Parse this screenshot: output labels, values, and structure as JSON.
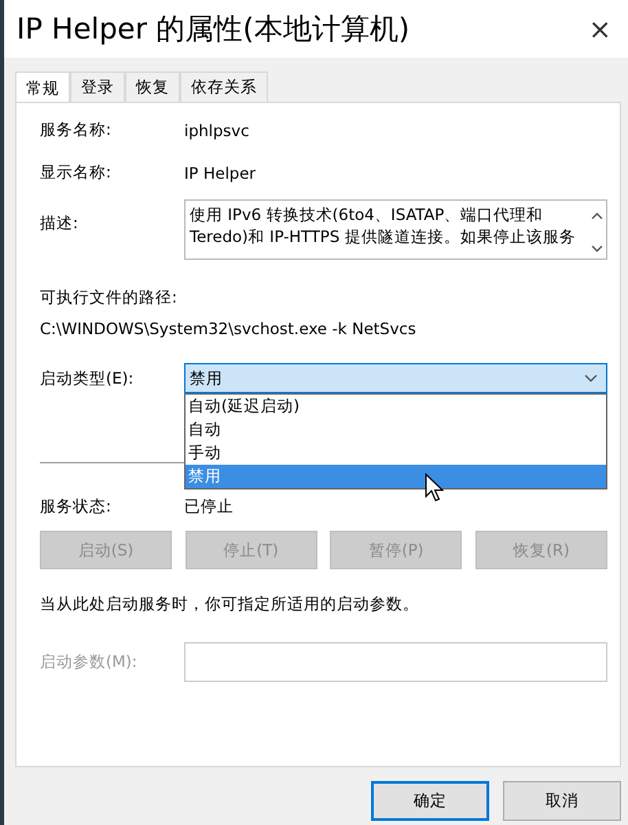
{
  "window": {
    "title": "IP Helper 的属性(本地计算机)",
    "close": "×"
  },
  "tabs": [
    {
      "label": "常规",
      "selected": true
    },
    {
      "label": "登录",
      "selected": false
    },
    {
      "label": "恢复",
      "selected": false
    },
    {
      "label": "依存关系",
      "selected": false
    }
  ],
  "service_name": {
    "label": "服务名称:",
    "value": "iphlpsvc"
  },
  "display_name": {
    "label": "显示名称:",
    "value": "IP Helper"
  },
  "description": {
    "label": "描述:",
    "text": "使用 IPv6 转换技术(6to4、ISATAP、端口代理和 Teredo)和 IP-HTTPS 提供隧道连接。如果停止该服务"
  },
  "executable_path": {
    "label": "可执行文件的路径:",
    "value": "C:\\WINDOWS\\System32\\svchost.exe -k NetSvcs"
  },
  "startup_type": {
    "label": "启动类型(E):",
    "value": "禁用",
    "expanded": true,
    "options": [
      {
        "label": "自动(延迟启动)",
        "selected": false
      },
      {
        "label": "自动",
        "selected": false
      },
      {
        "label": "手动",
        "selected": false
      },
      {
        "label": "禁用",
        "selected": true
      }
    ]
  },
  "service_status": {
    "label": "服务状态:",
    "value": "已停止"
  },
  "service_buttons": [
    {
      "label": "启动(S)",
      "disabled": true
    },
    {
      "label": "停止(T)",
      "disabled": true
    },
    {
      "label": "暂停(P)",
      "disabled": true
    },
    {
      "label": "恢复(R)",
      "disabled": true
    }
  ],
  "hint": "当从此处启动服务时，你可指定所适用的启动参数。",
  "start_parameters": {
    "label": "启动参数(M):",
    "disabled": true
  },
  "dialog_buttons": [
    {
      "label": "确定",
      "default": true
    },
    {
      "label": "取消",
      "default": false
    }
  ]
}
